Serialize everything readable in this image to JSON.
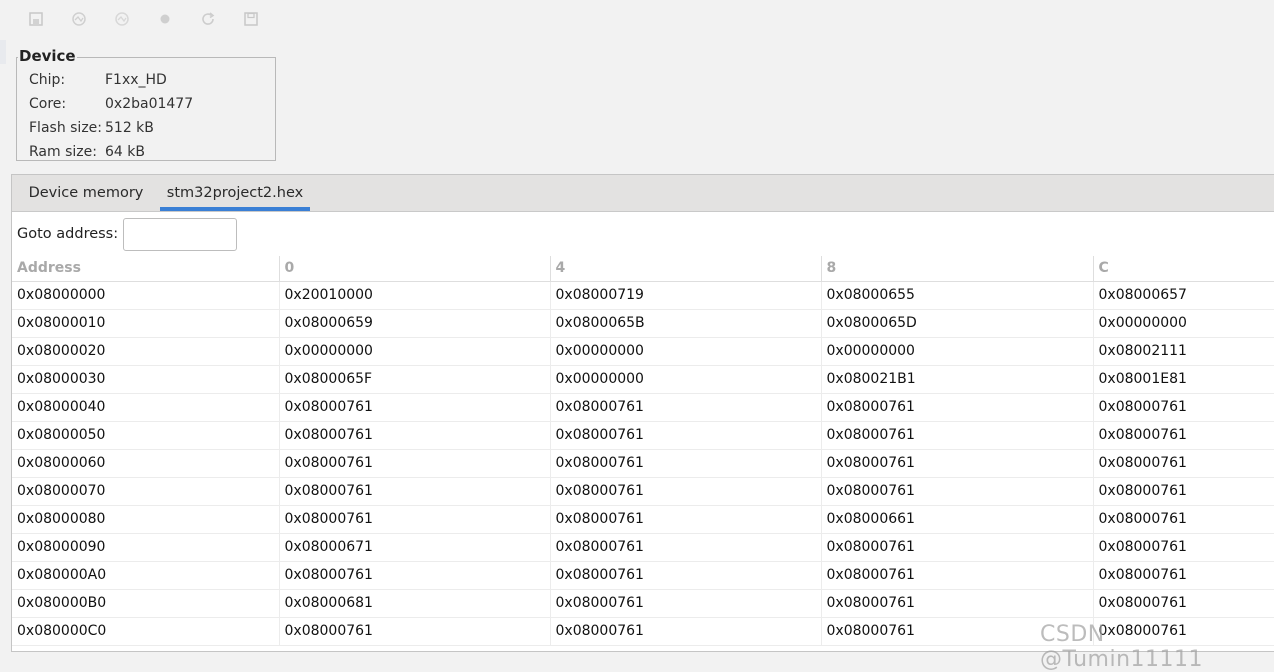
{
  "toolbar": {
    "icons": [
      "save-device-icon",
      "connect-icon",
      "disconnect-icon",
      "record-icon",
      "refresh-icon",
      "save-icon"
    ]
  },
  "device": {
    "title": "Device",
    "rows": [
      {
        "label": "Chip:",
        "value": "F1xx_HD"
      },
      {
        "label": "Core:",
        "value": "0x2ba01477"
      },
      {
        "label": "Flash size:",
        "value": "512 kB"
      },
      {
        "label": "Ram size:",
        "value": "64 kB"
      }
    ]
  },
  "tabs": [
    {
      "label": "Device memory",
      "active": false
    },
    {
      "label": "stm32project2.hex",
      "active": true
    }
  ],
  "goto": {
    "label": "Goto address:",
    "value": ""
  },
  "table": {
    "headers": [
      "Address",
      "0",
      "4",
      "8",
      "C"
    ],
    "rows": [
      [
        "0x08000000",
        "0x20010000",
        "0x08000719",
        "0x08000655",
        "0x08000657"
      ],
      [
        "0x08000010",
        "0x08000659",
        "0x0800065B",
        "0x0800065D",
        "0x00000000"
      ],
      [
        "0x08000020",
        "0x00000000",
        "0x00000000",
        "0x00000000",
        "0x08002111"
      ],
      [
        "0x08000030",
        "0x0800065F",
        "0x00000000",
        "0x080021B1",
        "0x08001E81"
      ],
      [
        "0x08000040",
        "0x08000761",
        "0x08000761",
        "0x08000761",
        "0x08000761"
      ],
      [
        "0x08000050",
        "0x08000761",
        "0x08000761",
        "0x08000761",
        "0x08000761"
      ],
      [
        "0x08000060",
        "0x08000761",
        "0x08000761",
        "0x08000761",
        "0x08000761"
      ],
      [
        "0x08000070",
        "0x08000761",
        "0x08000761",
        "0x08000761",
        "0x08000761"
      ],
      [
        "0x08000080",
        "0x08000761",
        "0x08000761",
        "0x08000661",
        "0x08000761"
      ],
      [
        "0x08000090",
        "0x08000671",
        "0x08000761",
        "0x08000761",
        "0x08000761"
      ],
      [
        "0x080000A0",
        "0x08000761",
        "0x08000761",
        "0x08000761",
        "0x08000761"
      ],
      [
        "0x080000B0",
        "0x08000681",
        "0x08000761",
        "0x08000761",
        "0x08000761"
      ],
      [
        "0x080000C0",
        "0x08000761",
        "0x08000761",
        "0x08000761",
        "0x08000761"
      ]
    ]
  },
  "watermark": "CSDN @Tumin11111"
}
